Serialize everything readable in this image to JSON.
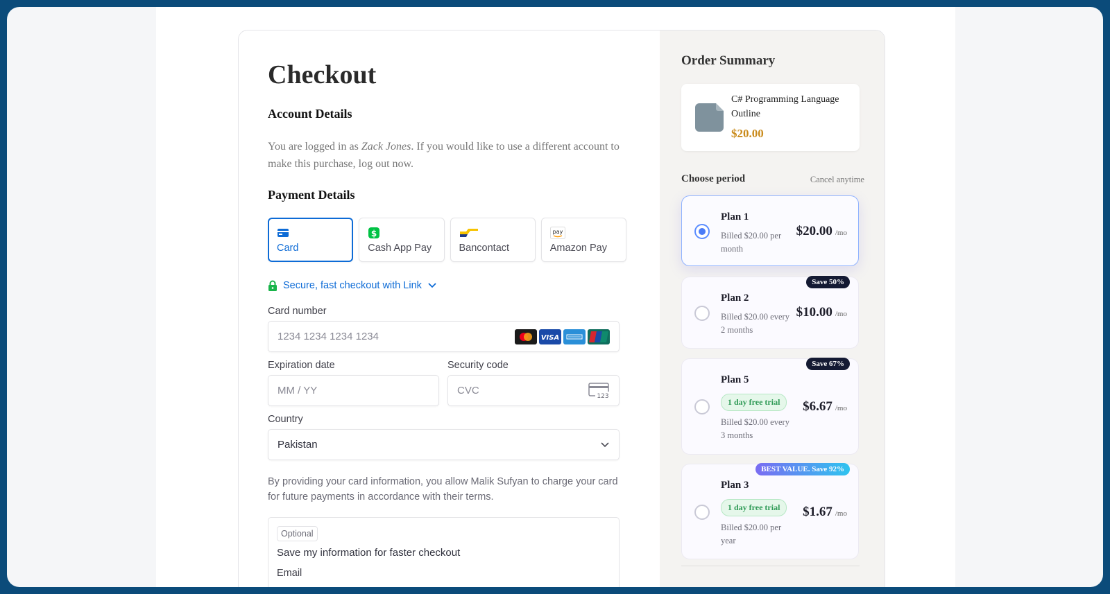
{
  "checkout": {
    "title": "Checkout",
    "account_heading": "Account Details",
    "account_text_pre": "You are logged in as ",
    "account_user": "Zack Jones",
    "account_text_post": ". If you would like to use a different account to make this purchase, log out now.",
    "payment_heading": "Payment Details",
    "tabs": [
      {
        "label": "Card",
        "icon": "card-icon"
      },
      {
        "label": "Cash App Pay",
        "icon": "cash-app-icon"
      },
      {
        "label": "Bancontact",
        "icon": "bancontact-icon"
      },
      {
        "label": "Amazon Pay",
        "icon": "amazon-pay-icon"
      }
    ],
    "link_text": "Secure, fast checkout with Link",
    "card_number_label": "Card number",
    "card_number_placeholder": "1234 1234 1234 1234",
    "expiration_label": "Expiration date",
    "expiration_placeholder": "MM / YY",
    "security_label": "Security code",
    "security_placeholder": "CVC",
    "cvc_icon_text": "123",
    "country_label": "Country",
    "country_value": "Pakistan",
    "consent_text": "By providing your card information, you allow Malik Sufyan to charge your card for future payments in accordance with their terms.",
    "optional_tag": "Optional",
    "save_info_text": "Save my information for faster checkout",
    "email_label": "Email"
  },
  "summary": {
    "title": "Order Summary",
    "product_name": "C# Programming Language Outline",
    "product_price": "$20.00",
    "choose_period": "Choose period",
    "cancel_anytime": "Cancel anytime",
    "plans": [
      {
        "name": "Plan 1",
        "billed": "Billed $20.00 per month",
        "price": "$20.00",
        "per": "/mo",
        "badge": "",
        "trial": ""
      },
      {
        "name": "Plan 2",
        "billed": "Billed $20.00 every 2 months",
        "price": "$10.00",
        "per": "/mo",
        "badge": "Save 50%",
        "trial": ""
      },
      {
        "name": "Plan 5",
        "billed": "Billed $20.00 every 3 months",
        "price": "$6.67",
        "per": "/mo",
        "badge": "Save 67%",
        "trial": "1 day free trial"
      },
      {
        "name": "Plan 3",
        "billed": "Billed $20.00 per year",
        "price": "$1.67",
        "per": "/mo",
        "badge": "BEST VALUE. Save 92%",
        "trial": "1 day free trial"
      }
    ],
    "selected_plan": "Plan 1"
  },
  "colors": {
    "accent": "#0d6bd6",
    "price_gold": "#c98a1a",
    "trial_green": "#2f9a56",
    "frame_blue": "#0b4b7a"
  }
}
